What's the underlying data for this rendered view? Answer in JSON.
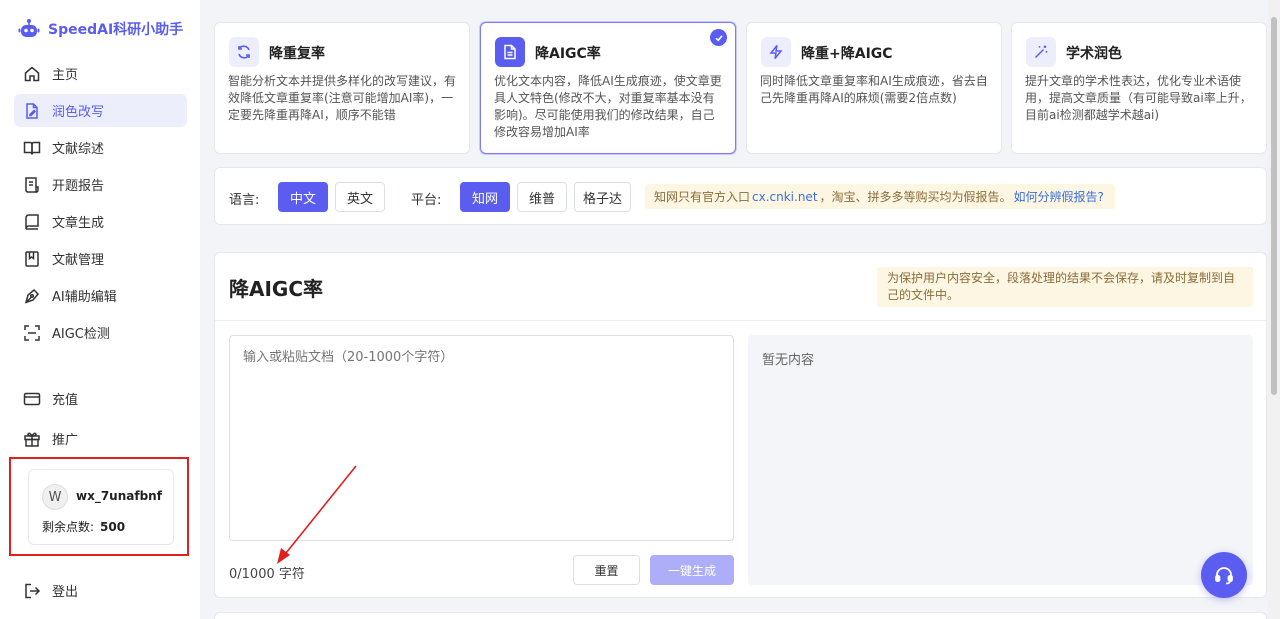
{
  "brand": {
    "name": "SpeedAI科研小助手"
  },
  "sidebar": {
    "items": [
      {
        "label": "主页",
        "icon": "home-icon"
      },
      {
        "label": "润色改写",
        "icon": "edit-doc-icon",
        "active": true
      },
      {
        "label": "文献综述",
        "icon": "book-open-icon"
      },
      {
        "label": "开题报告",
        "icon": "report-icon"
      },
      {
        "label": "文章生成",
        "icon": "article-icon"
      },
      {
        "label": "文献管理",
        "icon": "bookmark-icon"
      },
      {
        "label": "AI辅助编辑",
        "icon": "pen-nib-icon"
      },
      {
        "label": "AIGC检测",
        "icon": "scan-icon"
      }
    ],
    "bottom_items": [
      {
        "label": "充值",
        "icon": "credit-card-icon"
      },
      {
        "label": "推广",
        "icon": "gift-icon"
      }
    ],
    "user": {
      "avatar": "W",
      "name": "wx_7unafbnf",
      "points_label": "剩余点数:",
      "points": "500"
    },
    "logout": "登出"
  },
  "modes": [
    {
      "title": "降重复率",
      "icon": "refresh-icon",
      "desc": "智能分析文本并提供多样化的改写建议，有效降低文章重复率(注意可能增加AI率)，一定要先降重再降AI，顺序不能错"
    },
    {
      "title": "降AIGC率",
      "icon": "document-icon",
      "active": true,
      "desc": "优化文本内容，降低AI生成痕迹，使文章更具人文特色(修改不大，对重复率基本没有影响)。尽可能使用我们的修改结果，自己修改容易增加AI率"
    },
    {
      "title": "降重+降AIGC",
      "icon": "lightning-icon",
      "desc": "同时降低文章重复率和AI生成痕迹，省去自己先降重再降AI的麻烦(需要2倍点数)"
    },
    {
      "title": "学术润色",
      "icon": "magic-wand-icon",
      "desc": "提升文章的学术性表达，优化专业术语使用，提高文章质量（有可能导致ai率上升，目前ai检测都越学术越ai)"
    }
  ],
  "options": {
    "language_label": "语言:",
    "languages": [
      {
        "label": "中文",
        "selected": true
      },
      {
        "label": "英文",
        "selected": false
      }
    ],
    "platform_label": "平台:",
    "platforms": [
      {
        "label": "知网",
        "selected": true
      },
      {
        "label": "维普",
        "selected": false
      },
      {
        "label": "格子达",
        "selected": false
      }
    ],
    "notice_prefix": "知网只有官方入口",
    "notice_link": "cx.cnki.net",
    "notice_mid": "，淘宝、拼多多等购买均为假报告。",
    "notice_help": "如何分辨假报告?"
  },
  "editor": {
    "title": "降AIGC率",
    "tip": "为保护用户内容安全，段落处理的结果不会保存，请及时复制到自己的文件中。",
    "placeholder": "输入或粘贴文档（20-1000个字符）",
    "counter": "0/1000",
    "counter_unit": "字符",
    "reset_label": "重置",
    "generate_label": "一键生成",
    "output_empty": "暂无内容"
  },
  "colors": {
    "accent": "#5b5cf0",
    "annotation_red": "#e02020"
  }
}
